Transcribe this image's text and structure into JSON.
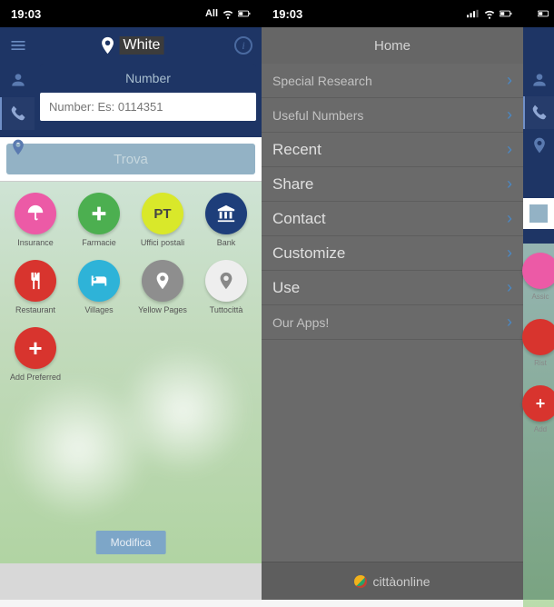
{
  "status": {
    "time": "19:03",
    "carrier": "All"
  },
  "left_screen": {
    "title": "White",
    "search": {
      "label": "Number",
      "placeholder": "Number: Es: 0114351",
      "submit_label": "Trova"
    },
    "categories": [
      {
        "id": "insurance",
        "label": "Insurance",
        "style": "c-pink",
        "glyph": "umbrella"
      },
      {
        "id": "farmacie",
        "label": "Farmacie",
        "style": "c-green",
        "glyph": "plus"
      },
      {
        "id": "uffici",
        "label": "Uffici postali",
        "style": "c-yellow",
        "glyph": "text",
        "text": "PT"
      },
      {
        "id": "bank",
        "label": "Bank",
        "style": "c-navy",
        "glyph": "bank"
      },
      {
        "id": "restaurant",
        "label": "Restaurant",
        "style": "c-red",
        "glyph": "food"
      },
      {
        "id": "villages",
        "label": "Villages",
        "style": "c-cyan",
        "glyph": "bed"
      },
      {
        "id": "yellow",
        "label": "Yellow Pages",
        "style": "c-grey",
        "glyph": "pin"
      },
      {
        "id": "tuttocitta",
        "label": "Tuttocittà",
        "style": "c-white",
        "glyph": "pin-grey"
      }
    ],
    "add_pref_label": "Add Preferred",
    "modifica_label": "Modifica"
  },
  "right_screen": {
    "header": "Home",
    "menu": [
      {
        "label": "Special Research",
        "big": false
      },
      {
        "label": "Useful Numbers",
        "big": false
      },
      {
        "label": "Recent",
        "big": true
      },
      {
        "label": "Share",
        "big": true
      },
      {
        "label": "Contact",
        "big": true
      },
      {
        "label": "Customize",
        "big": true
      },
      {
        "label": "Use",
        "big": true
      },
      {
        "label": "Our Apps!",
        "big": false
      }
    ],
    "footer_brand": "cittàonline"
  },
  "edge_strip": {
    "cat_labels": [
      "Assic",
      "Rist",
      "Add"
    ]
  }
}
